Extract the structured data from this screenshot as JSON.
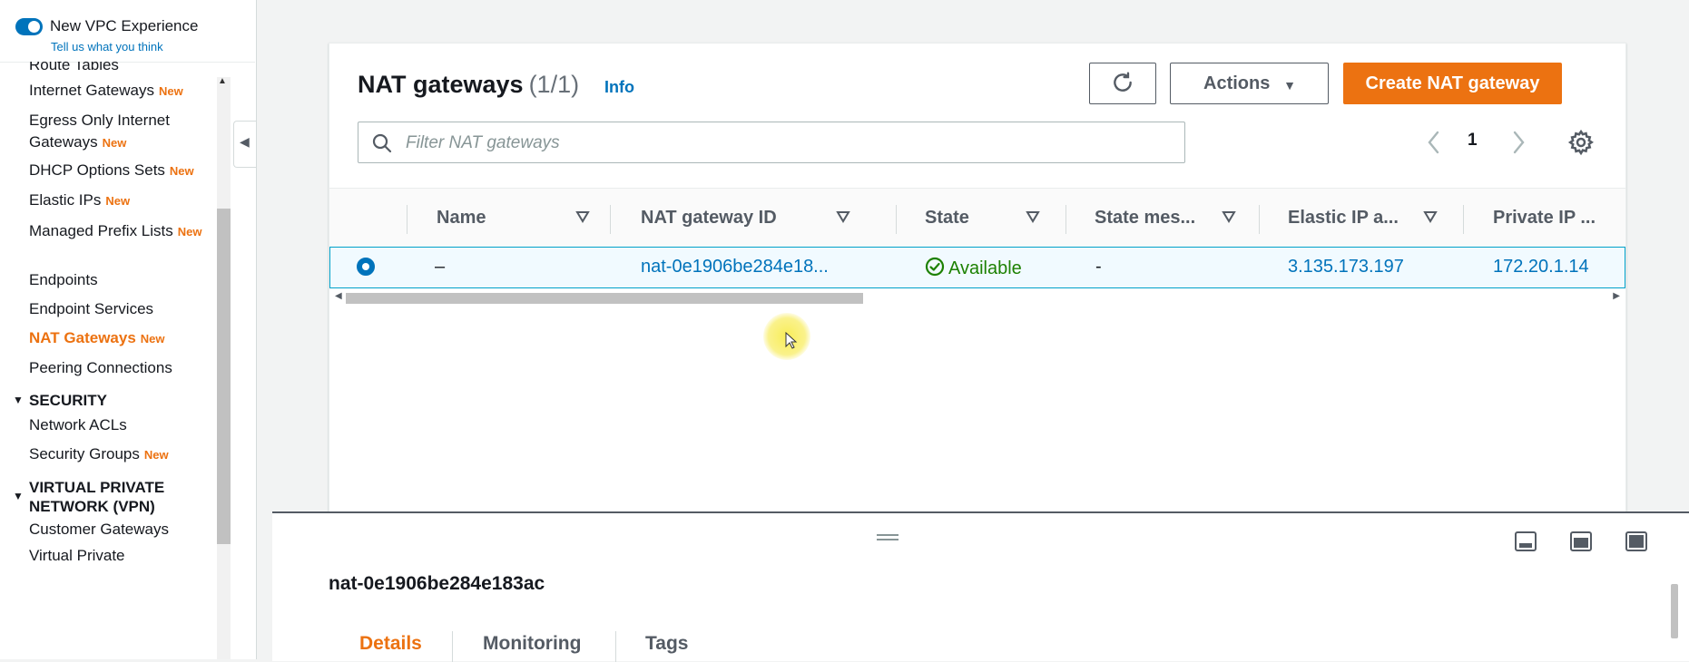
{
  "sidebar": {
    "experience": {
      "title": "New VPC Experience",
      "feedback": "Tell us what you think"
    },
    "new_badge": "New",
    "items": [
      {
        "label": "Route Tables",
        "new": false
      },
      {
        "label": "Internet Gateways",
        "new": true
      },
      {
        "label": "Egress Only Internet Gateways",
        "new": true
      },
      {
        "label": "DHCP Options Sets",
        "new": true
      },
      {
        "label": "Elastic IPs",
        "new": true
      },
      {
        "label": "Managed Prefix Lists",
        "new": true
      },
      {
        "label": "Endpoints",
        "new": false
      },
      {
        "label": "Endpoint Services",
        "new": false
      },
      {
        "label": "NAT Gateways",
        "new": true,
        "active": true
      },
      {
        "label": "Peering Connections",
        "new": false
      }
    ],
    "security": {
      "heading": "SECURITY",
      "items": [
        {
          "label": "Network ACLs",
          "new": false
        },
        {
          "label": "Security Groups",
          "new": true
        }
      ]
    },
    "vpn": {
      "heading_line1": "VIRTUAL PRIVATE",
      "heading_line2": "NETWORK (VPN)",
      "items": [
        {
          "label": "Customer Gateways",
          "new": false
        },
        {
          "label": "Virtual Private",
          "new": false
        }
      ]
    }
  },
  "main": {
    "title": "NAT gateways",
    "count": "(1/1)",
    "info": "Info",
    "actions_label": "Actions",
    "create_label": "Create NAT gateway",
    "filter_placeholder": "Filter NAT gateways",
    "page": "1",
    "columns": [
      "Name",
      "NAT gateway ID",
      "State",
      "State mes...",
      "Elastic IP a...",
      "Private IP ..."
    ],
    "row": {
      "name": "–",
      "id": "nat-0e1906be284e18...",
      "state": "Available",
      "state_message": "-",
      "elastic_ip": "3.135.173.197",
      "private_ip": "172.20.1.14"
    }
  },
  "details": {
    "title": "nat-0e1906be284e183ac",
    "tabs": [
      "Details",
      "Monitoring",
      "Tags"
    ]
  },
  "colors": {
    "accent": "#ec7211",
    "link": "#0073bb",
    "success": "#1d8102",
    "selected_row_bg": "#f1faff"
  }
}
